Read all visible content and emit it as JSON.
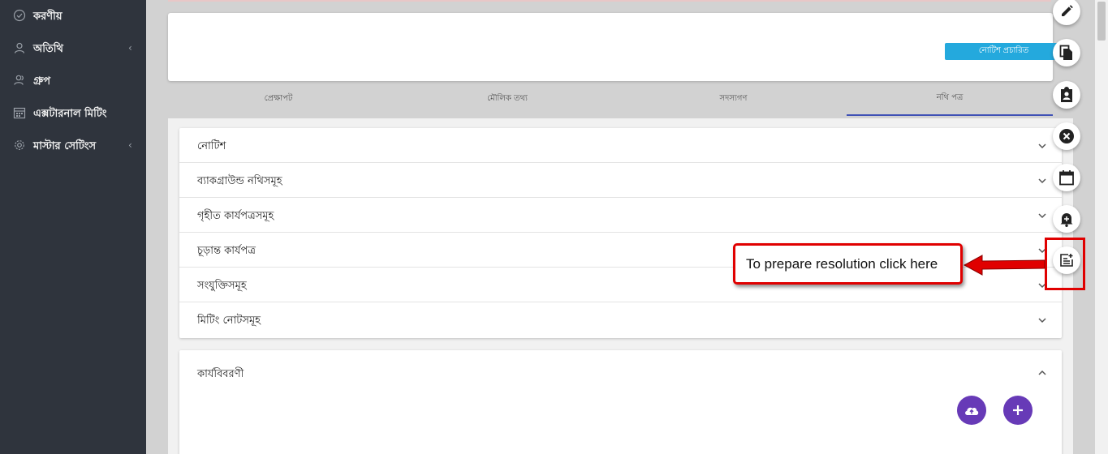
{
  "sidebar": {
    "items": [
      {
        "label": "করণীয়",
        "icon": "check-circle-icon",
        "has_chevron": false
      },
      {
        "label": "অতিথি",
        "icon": "user-icon",
        "has_chevron": true
      },
      {
        "label": "গ্রুপ",
        "icon": "group-icon",
        "has_chevron": false
      },
      {
        "label": "এক্সটারনাল মিটিং",
        "icon": "calendar-icon",
        "has_chevron": false
      },
      {
        "label": "মাস্টার সেটিংস",
        "icon": "gear-icon",
        "has_chevron": true
      }
    ],
    "chevron": "‹"
  },
  "header": {
    "notice_button": "নোটিশ প্রচারিত"
  },
  "tabs": [
    {
      "label": "প্রেক্ষাপট",
      "active": false
    },
    {
      "label": "মৌলিক তথ্য",
      "active": false
    },
    {
      "label": "সদস্যগণ",
      "active": false
    },
    {
      "label": "নথি পত্র",
      "active": true
    }
  ],
  "documents": {
    "sections": [
      "নোটিশ",
      "ব্যাকগ্রাউন্ড নথিসমূহ",
      "গৃহীত কার্যপত্রসমূহ",
      "চূড়ান্ত কার্যপত্র",
      "সংযুক্তিসমূহ",
      "মিটিং নোটসমূহ"
    ],
    "minutes_title": "কার্যবিবরণী"
  },
  "right_actions": [
    {
      "icon": "edit-icon"
    },
    {
      "icon": "copy-icon"
    },
    {
      "icon": "clipboard-user-icon"
    },
    {
      "icon": "close-circle-icon"
    },
    {
      "icon": "calendar-icon"
    },
    {
      "icon": "notification-add-icon"
    },
    {
      "icon": "resolution-add-icon"
    }
  ],
  "callout": {
    "text": "To prepare resolution click here"
  },
  "colors": {
    "sidebar_bg": "#2f343d",
    "accent_blue": "#24a9dd",
    "tab_active": "#3f51b5",
    "fab_purple": "#673ab7",
    "callout_red": "#e00000"
  }
}
